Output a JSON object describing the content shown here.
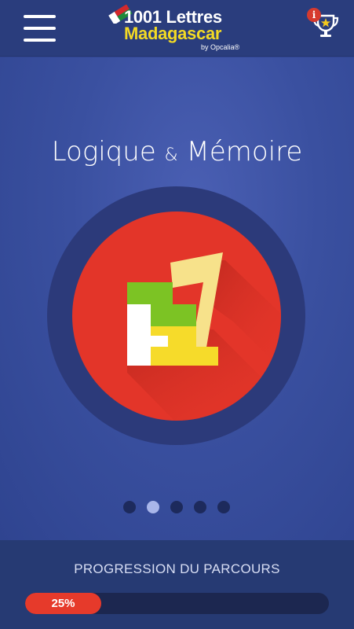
{
  "header": {
    "logo_line1": "1001 Lettres",
    "logo_line2": "Madagascar",
    "logo_by": "by Opcalia®",
    "info_badge": "i",
    "icons": {
      "menu": "hamburger-menu-icon",
      "trophy": "trophy-star-icon",
      "info": "info-icon"
    }
  },
  "slide": {
    "title_part1": "Logique",
    "title_amp": "&",
    "title_part2": "Mémoire",
    "icon": "tetris-blocks-icon"
  },
  "pagination": {
    "count": 5,
    "active_index": 1
  },
  "progress": {
    "label": "PROGRESSION DU PARCOURS",
    "value_text": "25%",
    "value": 0.25
  },
  "colors": {
    "background": "#2f4490",
    "header": "#2a3d7d",
    "accent_red": "#e33529",
    "logo_yellow": "#f3da24",
    "block_green": "#7cc324",
    "block_yellow": "#f6db2a",
    "block_cream": "#f7e28b",
    "active_dot": "#a9b6ea"
  }
}
